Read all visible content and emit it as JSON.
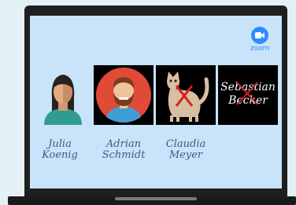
{
  "app": {
    "logo_text": "zoom",
    "logo_icon": "video-camera-icon"
  },
  "participants": [
    {
      "first": "Julia",
      "last": "Koenig",
      "tile": "avatar-woman"
    },
    {
      "first": "Adrian",
      "last": "Schmidt",
      "tile": "avatar-man-beard"
    },
    {
      "first": "Claudia",
      "last": "Meyer",
      "tile": "cat-photo-crossed-out"
    },
    {
      "first": "Sebastian",
      "last": "Becker",
      "tile": "name-only-crossed-out"
    }
  ],
  "colors": {
    "screen": "#c9e4fa",
    "zoom_blue": "#2d8cff",
    "name_text": "#3d5b7a",
    "cross_red": "#d12020"
  }
}
